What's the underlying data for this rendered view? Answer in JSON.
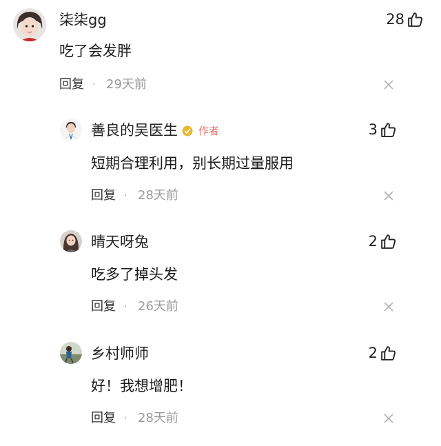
{
  "comments": [
    {
      "username": "柒柒gg",
      "content": "吃了会发胖",
      "likes": "28",
      "reply_label": "回复",
      "time": "29天前",
      "avatar_icon": "user-avatar-icon"
    },
    {
      "username": "善良的吴医生",
      "author_tag": "作者",
      "verified_icon": "verified-badge-icon",
      "content": "短期合理利用，别长期过量服用",
      "likes": "3",
      "reply_label": "回复",
      "time": "28天前",
      "avatar_icon": "user-avatar-icon"
    },
    {
      "username": "晴天呀兔",
      "content": "吃多了掉头发",
      "likes": "2",
      "reply_label": "回复",
      "time": "26天前",
      "avatar_icon": "user-avatar-icon"
    },
    {
      "username": "乡村师师",
      "content": "好！我想增肥！",
      "likes": "2",
      "reply_label": "回复",
      "time": "28天前",
      "avatar_icon": "user-avatar-icon"
    }
  ],
  "colors": {
    "author_tag": "#e5746a",
    "verified_badge": "#e8b930",
    "muted_text": "#9a9a9a"
  },
  "separator": "·",
  "like_icon": "thumbs-up-icon",
  "close_icon": "close-icon"
}
